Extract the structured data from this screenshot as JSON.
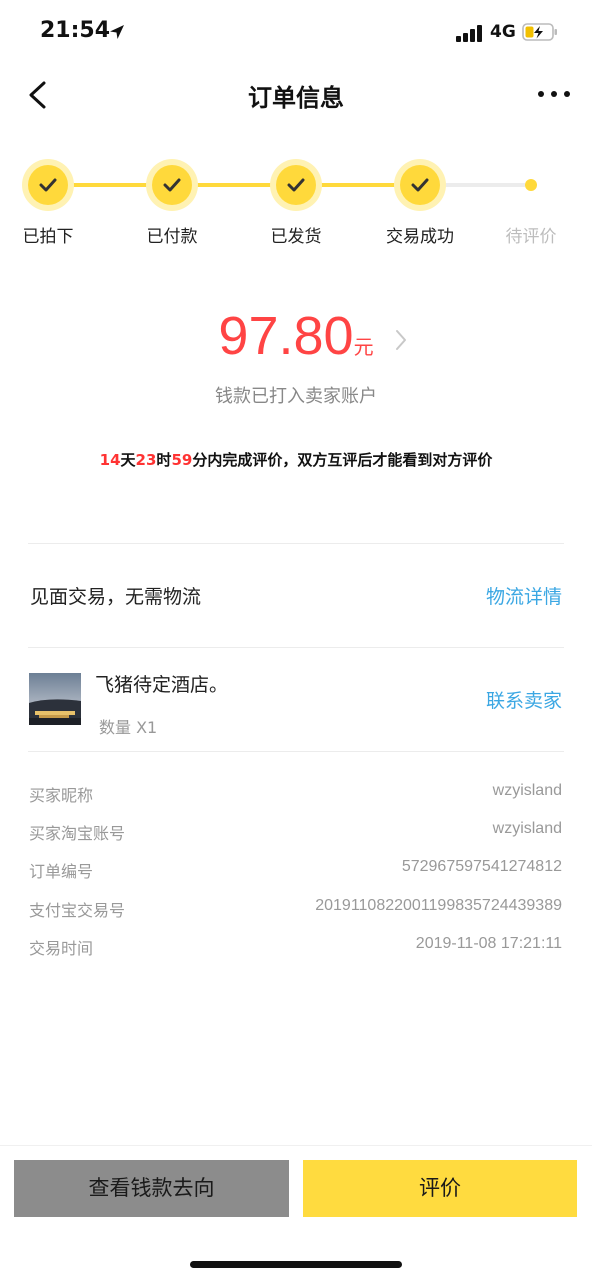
{
  "status_bar": {
    "time": "21:54",
    "network": "4G",
    "icons": [
      "location-arrow-icon",
      "signal-icon",
      "battery-charging-icon"
    ]
  },
  "nav": {
    "title": "订单信息",
    "back_icon": "chevron-left-icon",
    "more_icon": "more-dots-icon"
  },
  "progress": {
    "steps": [
      {
        "label": "已拍下",
        "done": true
      },
      {
        "label": "已付款",
        "done": true
      },
      {
        "label": "已发货",
        "done": true
      },
      {
        "label": "交易成功",
        "done": true
      },
      {
        "label": "待评价",
        "done": false
      }
    ],
    "active_color": "#ffd93b",
    "pending_color": "#ececec"
  },
  "payment": {
    "amount": "97.80",
    "unit": "元",
    "note": "钱款已打入卖家账户"
  },
  "countdown": {
    "days": "14",
    "days_unit": "天",
    "hours": "23",
    "hours_unit": "时",
    "minutes": "59",
    "text": "分内完成评价，双方互评后才能看到对方评价"
  },
  "logistics": {
    "text": "见面交易，无需物流",
    "link": "物流详情"
  },
  "product": {
    "name": "飞猪待定酒店。",
    "quantity": "数量 X1",
    "contact_link": "联系卖家"
  },
  "order_info": [
    {
      "label": "买家昵称",
      "value": "wzyisland"
    },
    {
      "label": "买家淘宝账号",
      "value": "wzyisland"
    },
    {
      "label": "订单编号",
      "value": "572967597541274812"
    },
    {
      "label": "支付宝交易号",
      "value": "2019110822001199835724439389"
    },
    {
      "label": "交易时间",
      "value": "2019-11-08 17:21:11"
    }
  ],
  "actions": {
    "money_flow": "查看钱款去向",
    "review": "评价"
  },
  "colors": {
    "accent": "#ffdb3f",
    "price": "#ff4444",
    "link": "#3ba7e3"
  }
}
